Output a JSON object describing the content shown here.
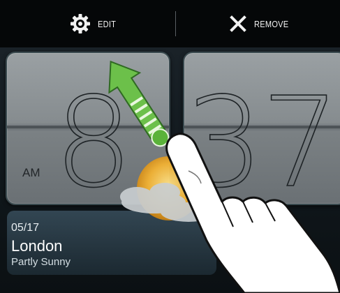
{
  "actions": {
    "edit_label": "EDIT",
    "remove_label": "REMOVE"
  },
  "clock": {
    "hour": "8",
    "minutes": "37",
    "period": "AM"
  },
  "weather": {
    "date": "05/17",
    "city": "London",
    "condition": "Partly Sunny",
    "icon": "partly-sunny-icon"
  },
  "gesture": {
    "icon": "hand-pointer-icon",
    "direction": "drag-up-arrow-icon"
  },
  "colors": {
    "arrow_green": "#6cc04a",
    "panel_gray": "#8a9093",
    "topbar": "#050708"
  }
}
